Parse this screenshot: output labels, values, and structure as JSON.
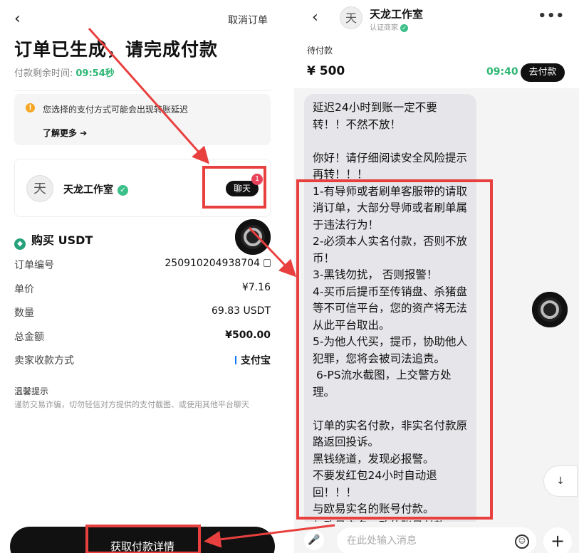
{
  "left": {
    "back_icon": "‹",
    "cancel_label": "取消订单",
    "title": "订单已生成，请完成付款",
    "timer_label": "付款剩余时间:",
    "timer_value": "09:54秒",
    "notice": {
      "icon": "!",
      "text": "您选择的支付方式可能会出现转账延迟",
      "more": "了解更多 ➔"
    },
    "seller": {
      "avatar": "天",
      "name": "天龙工作室",
      "verify_icon": "✓",
      "chat_label": "聊天",
      "chat_badge": "1"
    },
    "buy_title": "购买 USDT",
    "rows": [
      {
        "label": "订单编号",
        "value": "250910204938704"
      },
      {
        "label": "单价",
        "value": "¥7.16"
      },
      {
        "label": "数量",
        "value": "69.83 USDT"
      },
      {
        "label": "总金额",
        "value": "¥500.00"
      },
      {
        "label": "卖家收款方式",
        "value": "支付宝"
      }
    ],
    "warm_title": "温馨提示",
    "warm_text": "谨防交易诈骗，切勿轻信对方提供的支付截图、或使用其他平台聊天",
    "pay_button": "获取付款详情"
  },
  "right": {
    "back_icon": "‹",
    "avatar": "天",
    "name": "天龙工作室",
    "subtitle": "认证商家",
    "more_icon": "•••",
    "order_status": "待付款",
    "amount": "¥ 500",
    "timer": "09:40",
    "go_pay": "去付款",
    "message": "延迟24小时到账一定不要转！！不然不放！\n\n你好！请仔细阅读安全风险提示再转！！！\n1-有导师或者刷单客服带的请取消订单，大部分导师或者刷单属于违法行为！\n2-必须本人实名付款，否则不放币！\n3-黑钱勿扰， 否则报警！\n4-买币后提币至传销盘、杀猪盘等不可信平台，您的资产将无法从此平台取出。\n5-为他人代买，提币，协助他人犯罪，您将会被司法追责。\n 6-PS流水截图，上交警方处理。\n\n订单的实名付款，非实名付款原路返回投诉。\n黑钱绕道，发现必报警。\n不要发红包24小时自动退回！！！\n与欧易实名的账号付款。\n与欧易实名一致的账号付款",
    "scroll_icon": "↓",
    "input_placeholder": "在此处输入消息",
    "mic_icon": "🎤",
    "emoji_icon": "☺",
    "plus_icon": "+"
  },
  "colors": {
    "accent_green": "#2bb673",
    "annotation_red": "#e8403f",
    "button_dark": "#111111"
  }
}
